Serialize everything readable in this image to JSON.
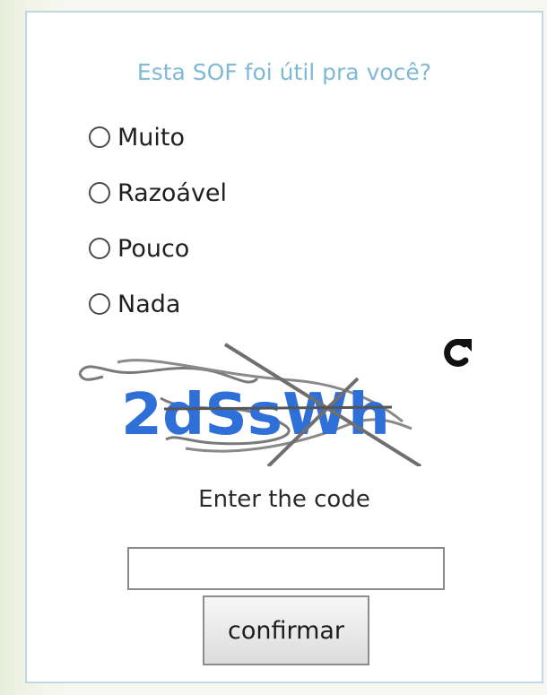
{
  "survey": {
    "question": "Esta SOF foi útil pra você?",
    "options": [
      {
        "label": "Muito",
        "selected": false
      },
      {
        "label": "Razoável",
        "selected": false
      },
      {
        "label": "Pouco",
        "selected": false
      },
      {
        "label": "Nada",
        "selected": false
      }
    ]
  },
  "captcha": {
    "code_text": "2dSsWh",
    "image_alt_color": "#2f6fd8",
    "refresh_icon": "refresh-icon",
    "prompt": "Enter the code",
    "input_value": "",
    "input_placeholder": ""
  },
  "actions": {
    "confirm_label": "confirmar"
  }
}
